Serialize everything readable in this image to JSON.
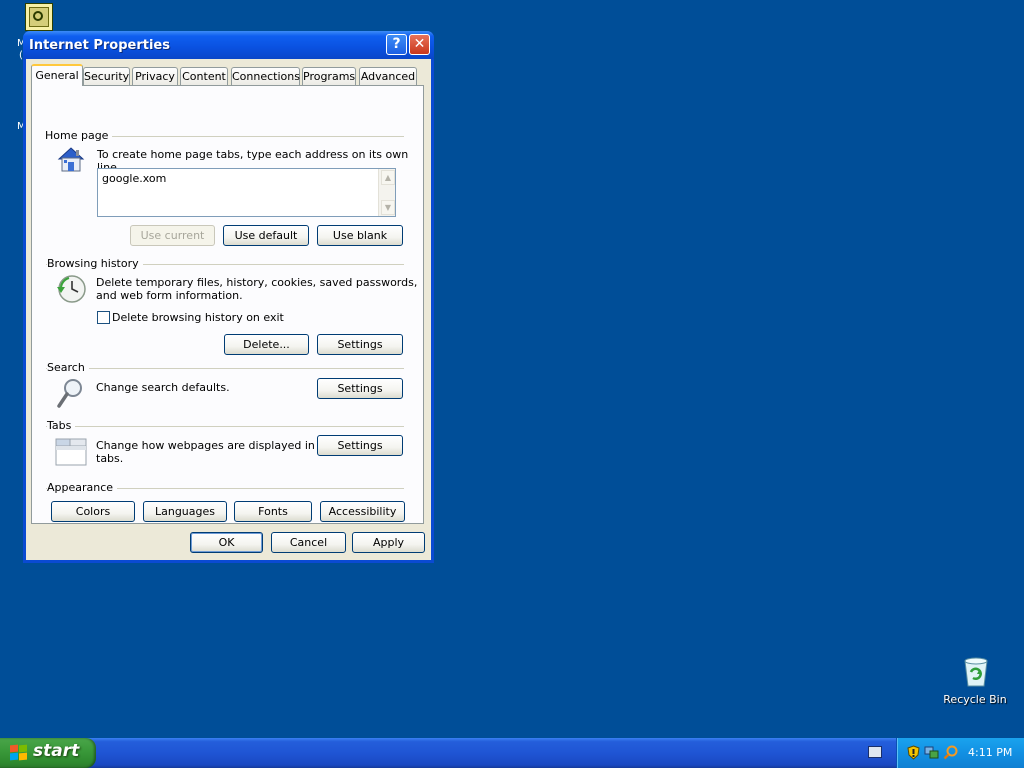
{
  "desktop": {
    "side_letter_1": "M",
    "side_letter_2": "(",
    "side_letter_3": "M",
    "recycle_bin_label": "Recycle Bin"
  },
  "taskbar": {
    "start_label": "start",
    "clock": "4:11 PM"
  },
  "dialog": {
    "title": "Internet Properties",
    "help_glyph": "?",
    "close_glyph": "✕",
    "tabs": [
      {
        "label": "General"
      },
      {
        "label": "Security"
      },
      {
        "label": "Privacy"
      },
      {
        "label": "Content"
      },
      {
        "label": "Connections"
      },
      {
        "label": "Programs"
      },
      {
        "label": "Advanced"
      }
    ],
    "active_tab": "General",
    "home_page": {
      "group_title": "Home page",
      "description": "To create home page tabs, type each address on its own line.",
      "value": "google.xom",
      "use_current": "Use current",
      "use_default": "Use default",
      "use_blank": "Use blank"
    },
    "browsing_history": {
      "group_title": "Browsing history",
      "description_line1": "Delete temporary files, history, cookies, saved passwords,",
      "description_line2": "and web form information.",
      "checkbox_label": "Delete browsing history on exit",
      "checkbox_checked": false,
      "delete_button": "Delete...",
      "settings_button": "Settings"
    },
    "search": {
      "group_title": "Search",
      "description": "Change search defaults.",
      "settings_button": "Settings"
    },
    "tabs_section": {
      "group_title": "Tabs",
      "description_line1": "Change how webpages are displayed in",
      "description_line2": "tabs.",
      "settings_button": "Settings"
    },
    "appearance": {
      "group_title": "Appearance",
      "colors": "Colors",
      "languages": "Languages",
      "fonts": "Fonts",
      "accessibility": "Accessibility"
    },
    "footer": {
      "ok": "OK",
      "cancel": "Cancel",
      "apply": "Apply"
    }
  },
  "colors": {
    "desktop_bg": "#004E98",
    "dialog_face": "#ECE9D8",
    "titlebar_blue": "#0A51E0",
    "active_tab_accent": "#FFC83C"
  }
}
